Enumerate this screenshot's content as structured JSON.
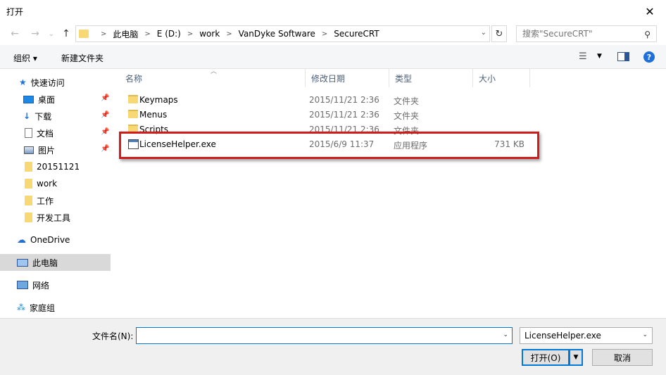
{
  "window": {
    "title": "打开",
    "close_glyph": "✕"
  },
  "nav": {
    "back": "←",
    "forward": "→",
    "recent": "⌄",
    "up": "↑",
    "refresh": "↻"
  },
  "breadcrumb": [
    "此电脑",
    "E (D:)",
    "work",
    "VanDyke Software",
    "SecureCRT"
  ],
  "search": {
    "placeholder": "搜索\"SecureCRT\""
  },
  "toolbar": {
    "organize": "组织 ▾",
    "new_folder": "新建文件夹"
  },
  "sidebar": {
    "items": [
      {
        "label": "快速访问",
        "icon": "star-icon",
        "pinned": false
      },
      {
        "label": "桌面",
        "icon": "desktop-icon",
        "pinned": true
      },
      {
        "label": "下载",
        "icon": "download-icon",
        "pinned": true
      },
      {
        "label": "文档",
        "icon": "document-icon",
        "pinned": true
      },
      {
        "label": "图片",
        "icon": "picture-icon",
        "pinned": true
      },
      {
        "label": "20151121",
        "icon": "folder-icon",
        "pinned": false
      },
      {
        "label": "work",
        "icon": "folder-icon",
        "pinned": false
      },
      {
        "label": "工作",
        "icon": "folder-icon",
        "pinned": false
      },
      {
        "label": "开发工具",
        "icon": "folder-icon",
        "pinned": false
      },
      {
        "label": "OneDrive",
        "icon": "cloud-icon",
        "pinned": false
      },
      {
        "label": "此电脑",
        "icon": "computer-icon",
        "pinned": false,
        "selected": true
      },
      {
        "label": "网络",
        "icon": "network-icon",
        "pinned": false
      },
      {
        "label": "家庭组",
        "icon": "homegroup-icon",
        "pinned": false
      }
    ]
  },
  "columns": {
    "name": "名称",
    "date": "修改日期",
    "type": "类型",
    "size": "大小"
  },
  "files": [
    {
      "name": "Keymaps",
      "date": "2015/11/21 2:36",
      "type": "文件夹",
      "size": "",
      "icon": "folder-icon"
    },
    {
      "name": "Menus",
      "date": "2015/11/21 2:36",
      "type": "文件夹",
      "size": "",
      "icon": "folder-icon"
    },
    {
      "name": "Scripts",
      "date": "2015/11/21 2:36",
      "type": "文件夹",
      "size": "",
      "icon": "folder-icon"
    },
    {
      "name": "LicenseHelper.exe",
      "date": "2015/6/9 11:37",
      "type": "应用程序",
      "size": "731 KB",
      "icon": "exe-icon"
    }
  ],
  "footer": {
    "filename_label": "文件名(N):",
    "filename_value": "",
    "filter_value": "LicenseHelper.exe",
    "open_label": "打开(O)",
    "cancel_label": "取消"
  },
  "colors": {
    "accent": "#0078d7",
    "highlight": "#d11c1c",
    "folder": "#f8d775",
    "selected": "#d9d9d9"
  }
}
